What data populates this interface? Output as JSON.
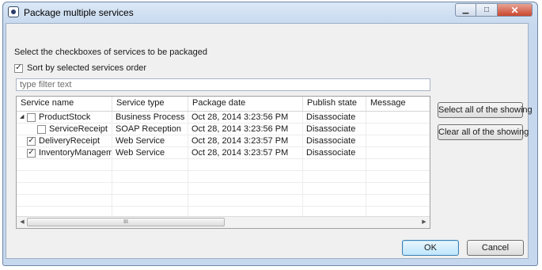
{
  "window": {
    "title": "Package multiple services",
    "buttons": {
      "minimize": "▁",
      "maximize": "□",
      "close": "✕"
    }
  },
  "instructions": "Select the checkboxes of services to be packaged",
  "sort_option": {
    "label": "Sort by selected services order",
    "checked": true
  },
  "filter": {
    "placeholder": "type filter text",
    "value": ""
  },
  "table": {
    "columns": [
      "Service name",
      "Service type",
      "Package date",
      "Publish state",
      "Message"
    ],
    "rows": [
      {
        "level": 0,
        "expanded": true,
        "checked": false,
        "name": "ProductStock",
        "type": "Business Process",
        "date": "Oct 28, 2014 3:23:56 PM",
        "state": "Disassociate",
        "message": ""
      },
      {
        "level": 1,
        "expanded": null,
        "checked": false,
        "name": "ServiceReceipt",
        "type": "SOAP Reception",
        "date": "Oct 28, 2014 3:23:56 PM",
        "state": "Disassociate",
        "message": ""
      },
      {
        "level": 0,
        "expanded": null,
        "checked": true,
        "name": "DeliveryReceipt",
        "type": "Web Service",
        "date": "Oct 28, 2014 3:23:57 PM",
        "state": "Disassociate",
        "message": ""
      },
      {
        "level": 0,
        "expanded": null,
        "checked": true,
        "name": "InventoryManageme",
        "type": "Web Service",
        "date": "Oct 28, 2014 3:23:57 PM",
        "state": "Disassociate",
        "message": ""
      }
    ],
    "scrollbar": {
      "left_arrow": "◀",
      "right_arrow": "▶",
      "grip": "III"
    }
  },
  "side_buttons": {
    "select_all": "Select all of the showing",
    "clear_all": "Clear all of the showing"
  },
  "footer": {
    "ok": "OK",
    "cancel": "Cancel"
  },
  "icons": {
    "expanded": "◢",
    "check": "✓"
  }
}
